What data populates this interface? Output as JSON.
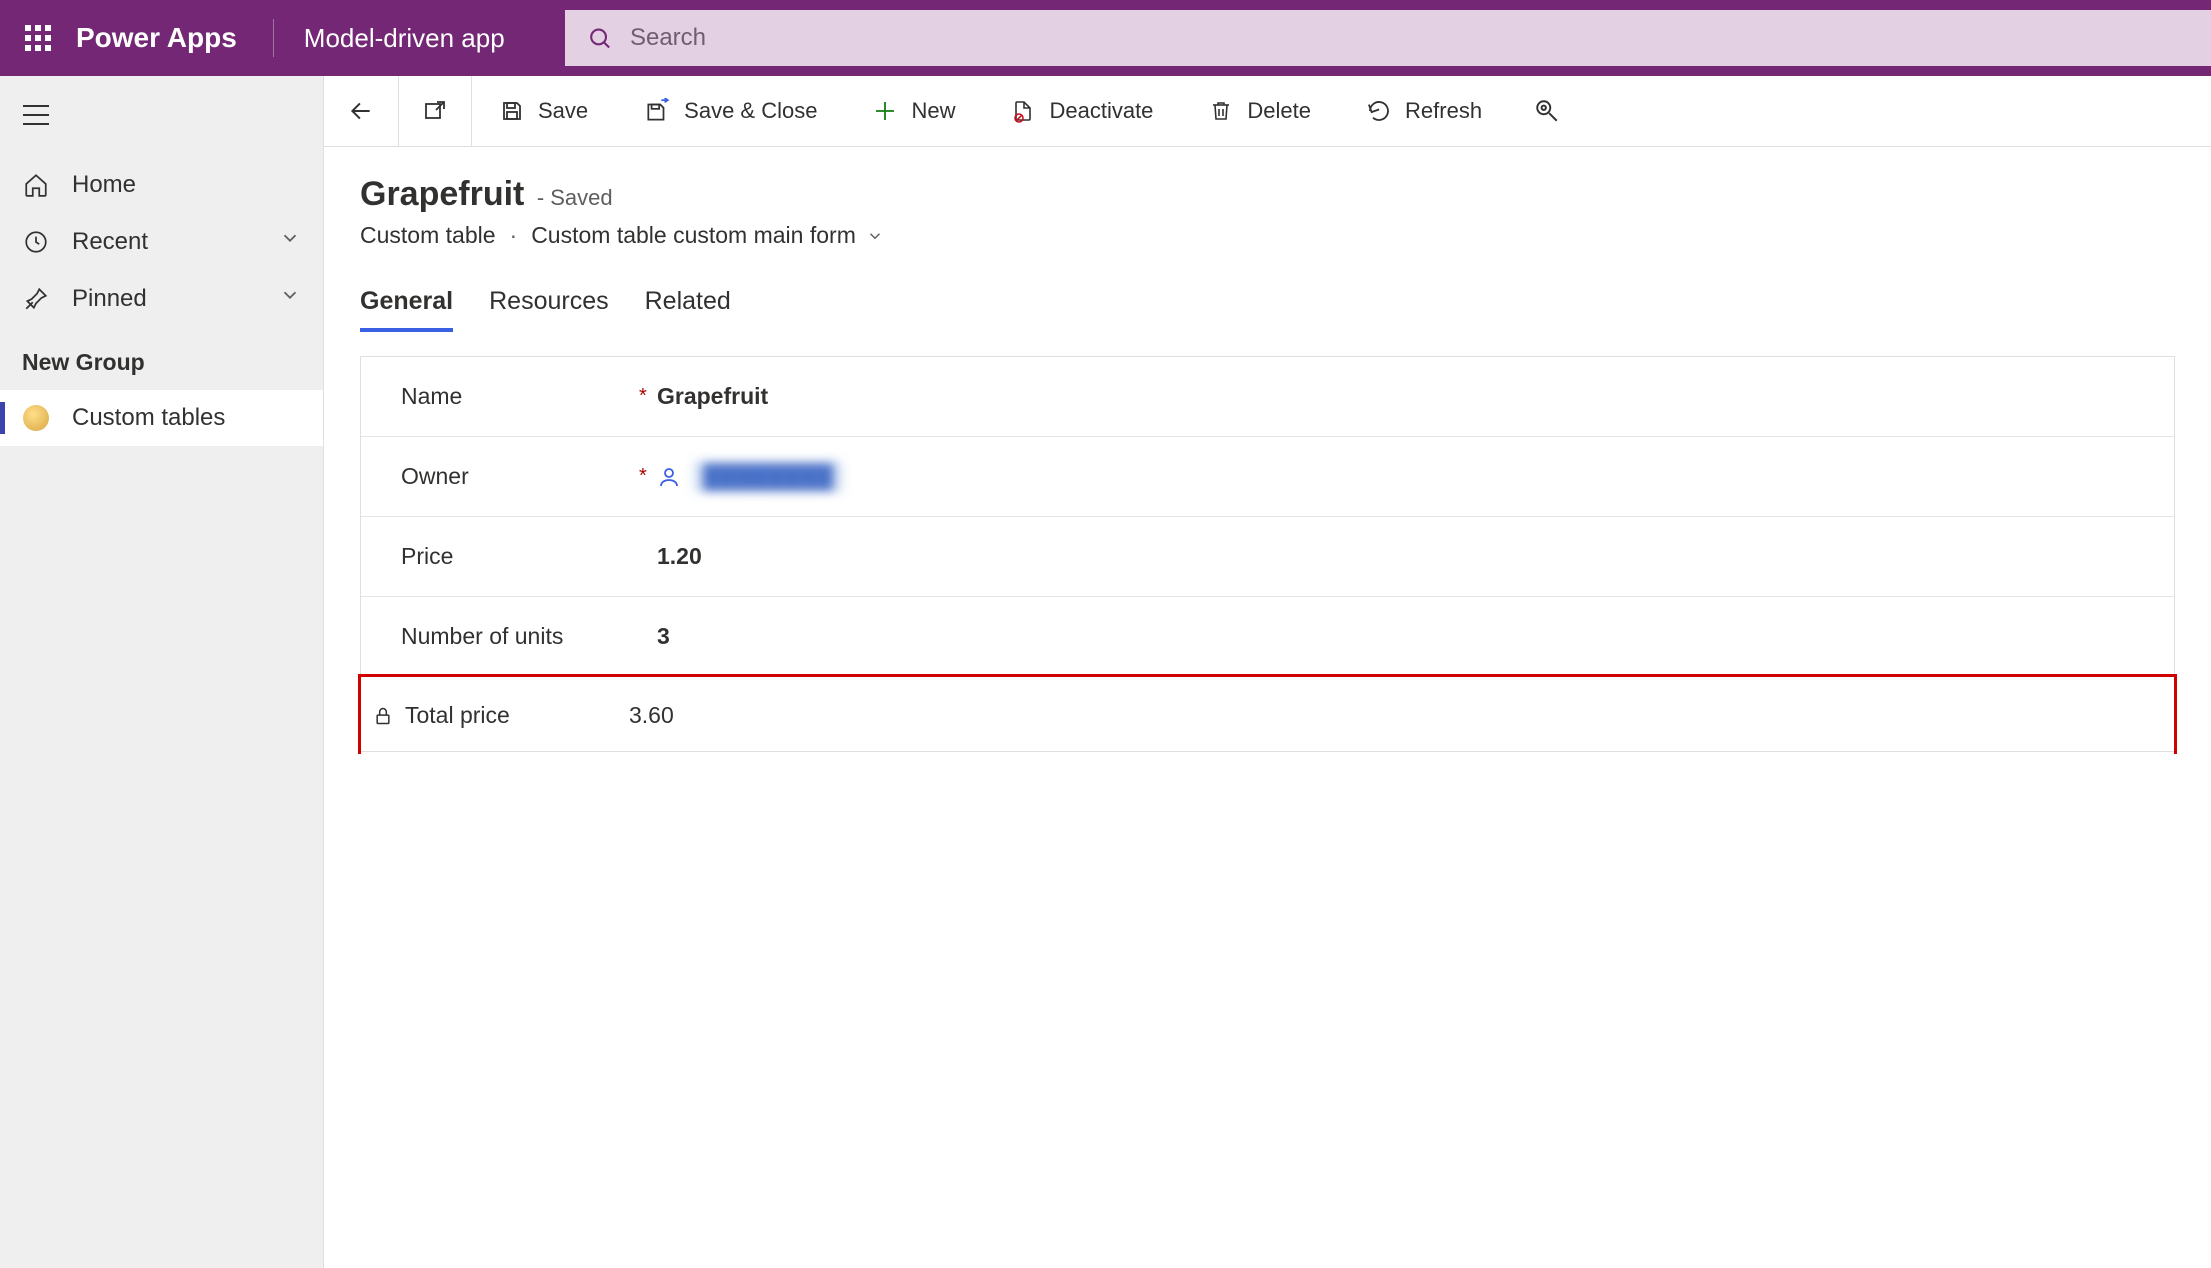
{
  "header": {
    "brand": "Power Apps",
    "app_name": "Model-driven app",
    "search_placeholder": "Search"
  },
  "sidebar": {
    "home": "Home",
    "recent": "Recent",
    "pinned": "Pinned",
    "group_label": "New Group",
    "custom_tables": "Custom tables"
  },
  "commands": {
    "save": "Save",
    "save_close": "Save & Close",
    "new": "New",
    "deactivate": "Deactivate",
    "delete": "Delete",
    "refresh": "Refresh"
  },
  "record": {
    "title": "Grapefruit",
    "status": "- Saved",
    "entity": "Custom table",
    "form": "Custom table custom main form"
  },
  "tabs": {
    "general": "General",
    "resources": "Resources",
    "related": "Related"
  },
  "form": {
    "name_label": "Name",
    "name_value": "Grapefruit",
    "owner_label": "Owner",
    "owner_value": "████████",
    "price_label": "Price",
    "price_value": "1.20",
    "units_label": "Number of units",
    "units_value": "3",
    "total_label": "Total price",
    "total_value": "3.60"
  }
}
